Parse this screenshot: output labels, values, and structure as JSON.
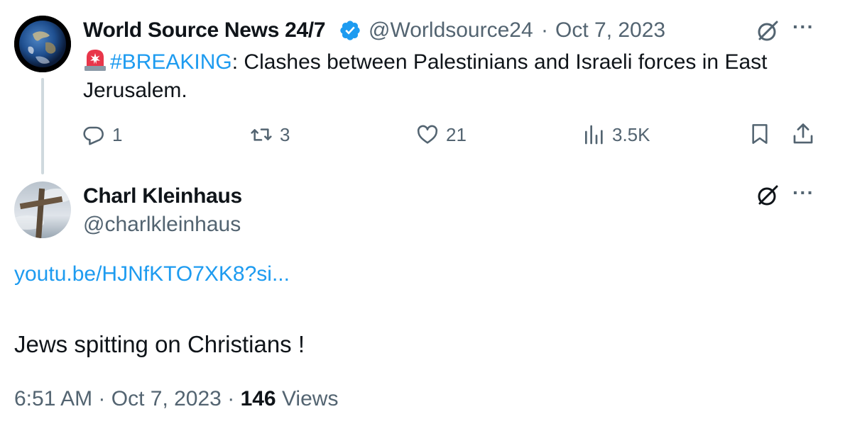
{
  "parent_tweet": {
    "display_name": "World Source News 24/7",
    "handle": "@Worldsource24",
    "separator": "·",
    "date": "Oct 7, 2023",
    "hashtag": "#BREAKING",
    "text_rest": ": Clashes between Palestinians and Israeli forces in East Jerusalem.",
    "more_label": "···",
    "actions": {
      "replies": "1",
      "retweets": "3",
      "likes": "21",
      "views": "3.5K"
    }
  },
  "main_tweet": {
    "display_name": "Charl Kleinhaus",
    "handle": "@charlkleinhaus",
    "more_label": "···",
    "link": "youtu.be/HJNfKTO7XK8?si...",
    "text": "Jews spitting on Christians !",
    "time": "6:51 AM",
    "separator": "·",
    "date": "Oct 7, 2023",
    "views_count": "146",
    "views_label": "Views"
  },
  "colors": {
    "accent": "#1d9bf0",
    "secondary_text": "#536471",
    "primary_text": "#0f1419",
    "thread_line": "#cfd9de"
  },
  "icons": [
    "verified-badge-icon",
    "siren-emoji-icon",
    "grok-icon",
    "reply-icon",
    "retweet-icon",
    "like-icon",
    "views-icon",
    "bookmark-icon",
    "share-icon",
    "more-icon"
  ]
}
